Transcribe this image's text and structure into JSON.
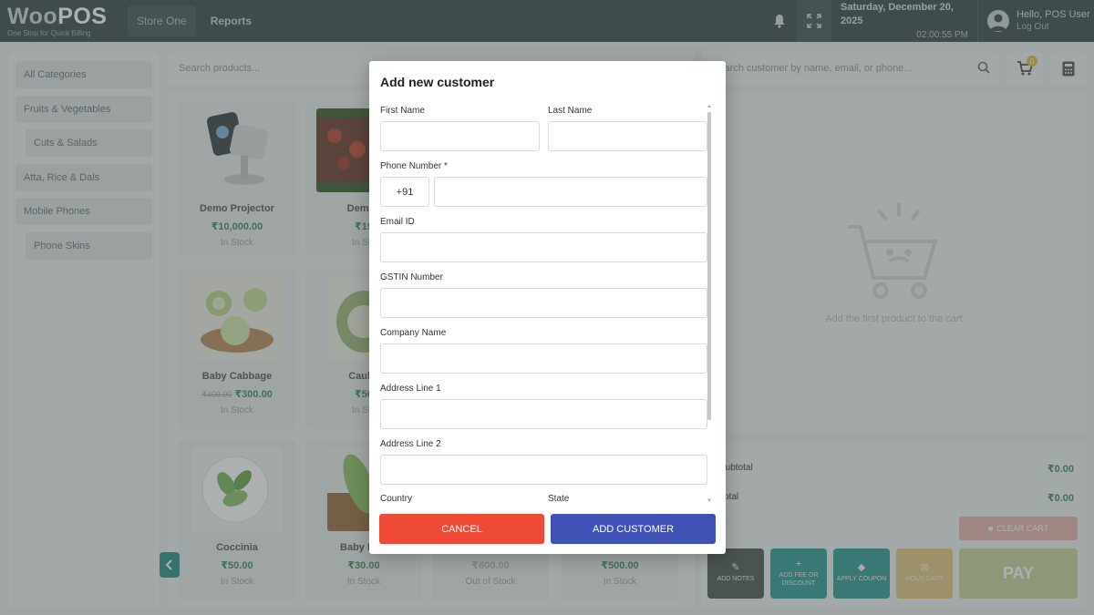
{
  "header": {
    "logo_light": "Woo",
    "logo_bold": "POS",
    "tagline": "One Stop for Quick Billing",
    "store": "Store One",
    "nav": "Reports",
    "date": "Saturday, December 20, 2025",
    "time": "02:00:55 PM",
    "greeting": "Hello, POS User",
    "logout": "Log Out"
  },
  "categories": [
    {
      "label": "All Categories",
      "sub": false
    },
    {
      "label": "Fruits & Vegetables",
      "sub": false
    },
    {
      "label": "Cuts & Salads",
      "sub": true
    },
    {
      "label": "Atta, Rice & Dals",
      "sub": false
    },
    {
      "label": "Mobile Phones",
      "sub": false
    },
    {
      "label": "Phone Skins",
      "sub": true
    }
  ],
  "products": {
    "search_placeholder": "Search products...",
    "items": [
      {
        "name": "Demo Projector",
        "price": "₹10,000.00",
        "old_price": "",
        "stock": "In Stock"
      },
      {
        "name": "Demo I",
        "price": "₹19",
        "old_price": "",
        "stock": "In Sto"
      },
      {
        "name": "Baby Cabbage",
        "price": "₹300.00",
        "old_price": "₹400.00",
        "stock": "In Stock"
      },
      {
        "name": "Caulifl",
        "price": "₹50",
        "old_price": "",
        "stock": "In Sto"
      },
      {
        "name": "Coccinia",
        "price": "₹50.00",
        "old_price": "",
        "stock": "In Stock"
      },
      {
        "name": "Baby Bott",
        "price": "₹30.00",
        "old_price": "",
        "stock": "In Stock"
      },
      {
        "name": "",
        "price": "₹600.00",
        "old_price": "",
        "stock": "Out of Stock"
      },
      {
        "name": "",
        "price": "₹500.00",
        "old_price": "",
        "stock": "In Stock"
      }
    ]
  },
  "cart": {
    "customer_search_placeholder": "Search customer by name, email, or phone...",
    "badge": "0",
    "empty_message": "Add the first product to the cart",
    "subtotal_label": "Subtotal",
    "subtotal_value": "₹0.00",
    "total_label": "Total",
    "total_value": "₹0.00",
    "clear_cart": "CLEAR CART",
    "actions": {
      "add_notes": "ADD NOTES",
      "add_fee": "ADD FEE OR DISCOUNT",
      "apply_coupon": "APPLY COUPON",
      "hold_cart": "HOLD CART",
      "pay": "PAY"
    },
    "action_colors": {
      "notes": "#4d5454",
      "fee": "#2e9a93",
      "coupon": "#2e9a93",
      "hold": "#e3c67e"
    }
  },
  "modal": {
    "title": "Add new customer",
    "first_name_label": "First Name",
    "first_name_value": "",
    "last_name_label": "Last Name",
    "last_name_value": "",
    "phone_label": "Phone Number *",
    "phone_code": "+91",
    "phone_value": "",
    "email_label": "Email ID",
    "email_value": "",
    "gstin_label": "GSTIN Number",
    "gstin_value": "",
    "company_label": "Company Name",
    "company_value": "",
    "address1_label": "Address Line 1",
    "address1_value": "",
    "address2_label": "Address Line 2",
    "address2_value": "",
    "country_label": "Country",
    "state_label": "State",
    "cancel_label": "CANCEL",
    "add_label": "ADD CUSTOMER"
  },
  "colors": {
    "header": "#3b4a4a",
    "cancel": "#ee4a36",
    "add_customer": "#3f51b5",
    "price_green": "#3a8a5c"
  }
}
